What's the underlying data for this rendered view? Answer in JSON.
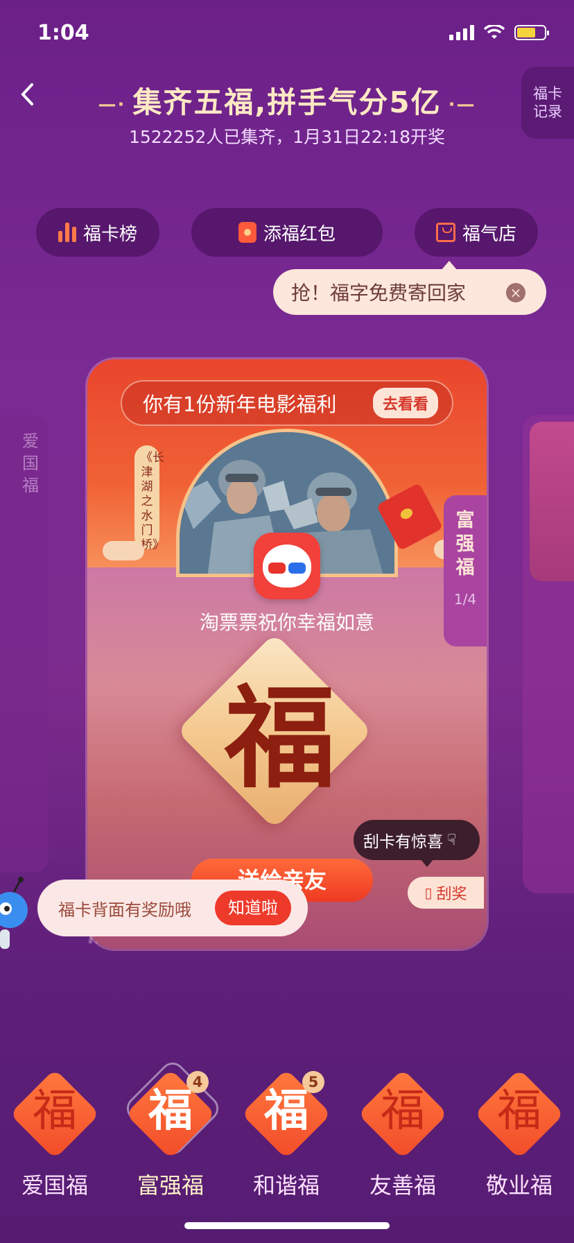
{
  "status": {
    "time": "1:04"
  },
  "header": {
    "title": "集齐五福,拼手气分5亿",
    "subtitle": "1522252人已集齐，1月31日22:18开奖",
    "record_label": "福卡记录"
  },
  "actions": [
    {
      "label": "福卡榜",
      "icon": "bar-chart-icon"
    },
    {
      "label": "添福红包",
      "icon": "red-envelope-icon"
    },
    {
      "label": "福气店",
      "icon": "shopping-bag-icon"
    }
  ],
  "tooltip": {
    "text": "抢！福字免费寄回家"
  },
  "side_left_label": "爱国福",
  "card": {
    "banner_text": "你有1份新年电影福利",
    "banner_action": "去看看",
    "movie_title": "《长津湖之水门桥》",
    "blessing": "淘票票祝你幸福如意",
    "fu_char": "福",
    "card_name": "富强福",
    "card_index": "1/4",
    "send_button": "送给亲友"
  },
  "scratch": {
    "tip": "刮卡有惊喜",
    "button": "刮奖"
  },
  "toast": {
    "text": "福卡背面有奖励哦",
    "button": "知道啦"
  },
  "collection": [
    {
      "name": "爱国福",
      "char": "福",
      "count": "",
      "active": false
    },
    {
      "name": "富强福",
      "char": "福",
      "count": "4",
      "active": true
    },
    {
      "name": "和谐福",
      "char": "福",
      "count": "5",
      "active": false
    },
    {
      "name": "友善福",
      "char": "福",
      "count": "",
      "active": false
    },
    {
      "name": "敬业福",
      "char": "福",
      "count": "",
      "active": false
    }
  ],
  "colors": {
    "accent_red": "#ee3a2b",
    "bg_purple": "#7a2a93",
    "gold": "#f4c98f"
  }
}
